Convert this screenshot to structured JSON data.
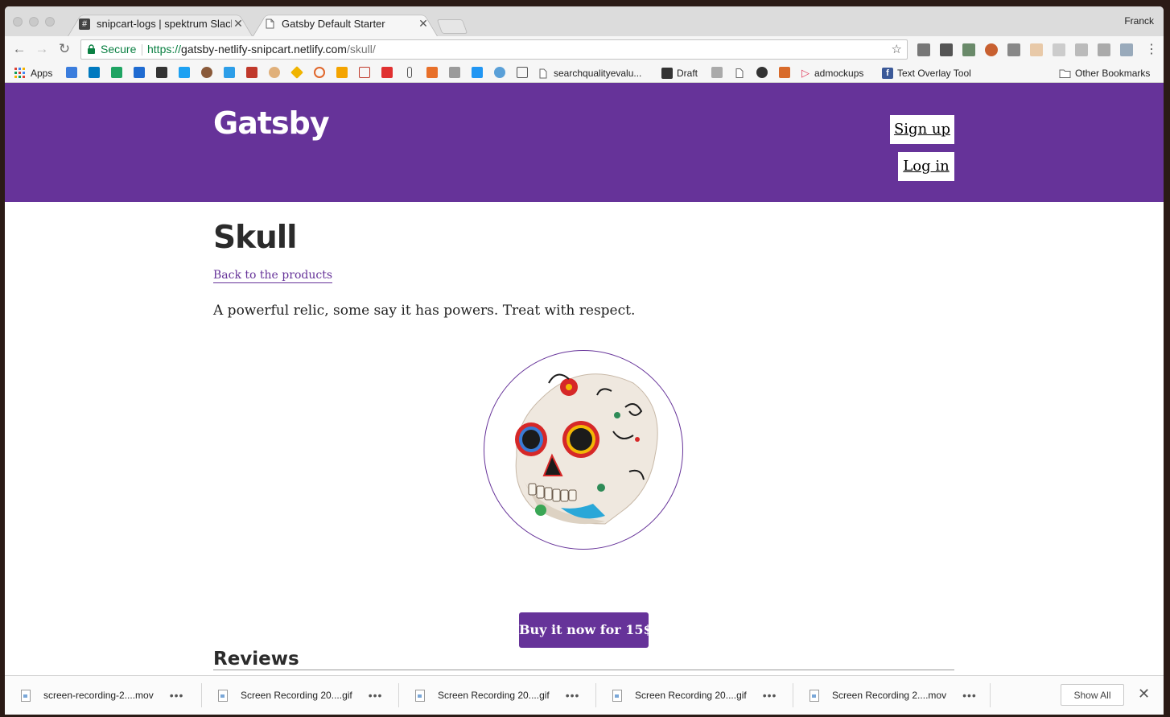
{
  "browser": {
    "profile_name": "Franck",
    "tabs": [
      {
        "title": "snipcart-logs | spektrum Slack",
        "favicon": "slack-hash-icon",
        "active": false
      },
      {
        "title": "Gatsby Default Starter",
        "favicon": "page-icon",
        "active": true
      }
    ],
    "omnibox": {
      "secure_label": "Secure",
      "url_scheme": "https://",
      "url_host": "gatsby-netlify-snipcart.netlify.com",
      "url_path": "/skull/"
    },
    "bookmarks": {
      "apps_label": "Apps",
      "items": [
        {
          "label": "searchqualityevalu..."
        },
        {
          "label": "Draft"
        },
        {
          "label": "admockups"
        },
        {
          "label": "Text Overlay Tool"
        }
      ],
      "other_label": "Other Bookmarks"
    }
  },
  "site": {
    "brand": "Gatsby",
    "signup_label": "Sign up",
    "login_label": "Log in",
    "accent_color": "#663399"
  },
  "product": {
    "title": "Skull",
    "back_link": "Back to the products",
    "description": "A powerful relic, some say it has powers. Treat with respect.",
    "buy_label": "Buy it now for 15$",
    "reviews_heading": "Reviews"
  },
  "downloads": {
    "items": [
      {
        "name": "screen-recording-2....mov"
      },
      {
        "name": "Screen Recording 20....gif"
      },
      {
        "name": "Screen Recording 20....gif"
      },
      {
        "name": "Screen Recording 20....gif"
      },
      {
        "name": "Screen Recording 2....mov"
      }
    ],
    "show_all_label": "Show All"
  }
}
